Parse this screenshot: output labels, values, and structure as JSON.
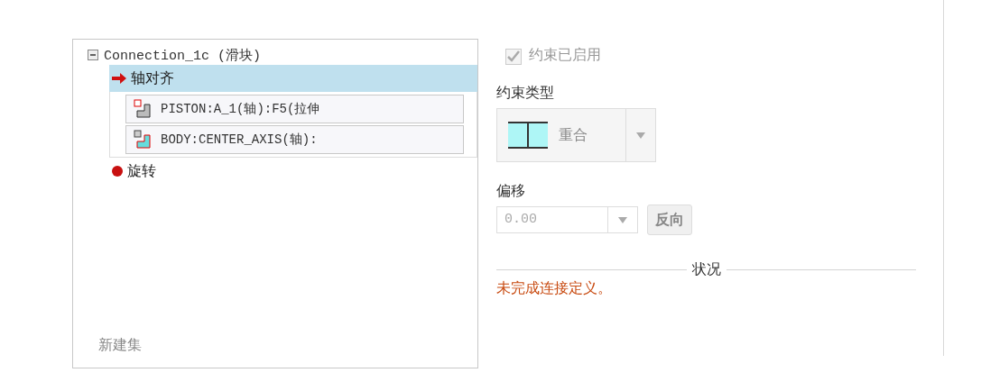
{
  "tree": {
    "root": {
      "label": "Connection_1c (滑块)",
      "expanded": true,
      "children": [
        {
          "label": "轴对齐",
          "kind": "arrow",
          "selected": true,
          "references": [
            {
              "label": "PISTON:A_1(轴):F5(拉伸",
              "kind": "first"
            },
            {
              "label": "BODY:CENTER_AXIS(轴):",
              "kind": "second"
            }
          ]
        },
        {
          "label": "旋转",
          "kind": "error",
          "selected": false
        }
      ]
    },
    "new_set": "新建集"
  },
  "constraint": {
    "enabled_label": "约束已启用",
    "enabled": true,
    "enabled_disabled": true,
    "type_label": "约束类型",
    "type_value": "重合",
    "offset_label": "偏移",
    "offset_value": "0.00",
    "flip_button": "反向"
  },
  "status": {
    "title": "状况",
    "message": "未完成连接定义。"
  }
}
